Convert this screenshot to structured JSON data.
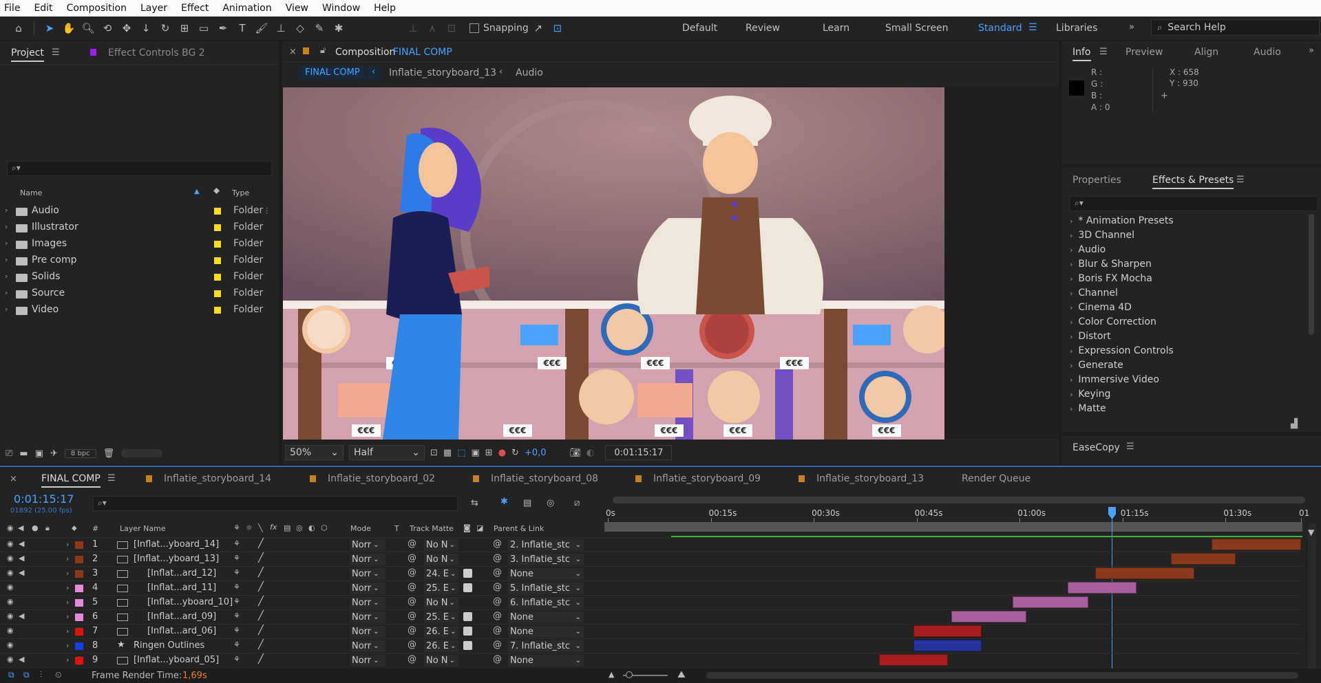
{
  "menu": [
    "File",
    "Edit",
    "Composition",
    "Layer",
    "Effect",
    "Animation",
    "View",
    "Window",
    "Help"
  ],
  "toolbar": {
    "snapping": "Snapping",
    "workspaces": [
      "Default",
      "Review",
      "Learn",
      "Small Screen",
      "Standard",
      "Libraries"
    ],
    "active_workspace": "Standard",
    "search_help": "Search Help"
  },
  "project": {
    "tab": "Project",
    "effect_controls": "Effect Controls BG 2",
    "col_name": "Name",
    "col_type": "Type",
    "bpc": "8 bpc",
    "items": [
      {
        "name": "Audio",
        "type": "Folder"
      },
      {
        "name": "Illustrator",
        "type": "Folder"
      },
      {
        "name": "Images",
        "type": "Folder"
      },
      {
        "name": "Pre comp",
        "type": "Folder"
      },
      {
        "name": "Solids",
        "type": "Folder"
      },
      {
        "name": "Source",
        "type": "Folder"
      },
      {
        "name": "Video",
        "type": "Folder"
      }
    ]
  },
  "comp": {
    "tab_prefix": "Composition",
    "tab_name": "FINAL COMP",
    "crumbs": [
      "FINAL COMP",
      "Inflatie_storyboard_13",
      "Audio"
    ],
    "zoom": "50%",
    "resolution": "Half",
    "exposure": "+0,0",
    "timecode": "0:01:15:17",
    "price_tag": "€€€"
  },
  "info": {
    "tabs": [
      "Info",
      "Preview",
      "Align",
      "Audio"
    ],
    "r": "R :",
    "g": "G :",
    "b": "B :",
    "a": "A :  0",
    "x": "X : 658",
    "y": "Y : 930"
  },
  "effects": {
    "tabs": [
      "Properties",
      "Effects & Presets"
    ],
    "items": [
      "* Animation Presets",
      "3D Channel",
      "Audio",
      "Blur & Sharpen",
      "Boris FX Mocha",
      "Channel",
      "Cinema 4D",
      "Color Correction",
      "Distort",
      "Expression Controls",
      "Generate",
      "Immersive Video",
      "Keying",
      "Matte"
    ],
    "easecopy": "EaseCopy"
  },
  "timeline": {
    "tabs": [
      "FINAL COMP",
      "Inflatie_storyboard_14",
      "Inflatie_storyboard_02",
      "Inflatie_storyboard_08",
      "Inflatie_storyboard_09",
      "Inflatie_storyboard_13",
      "Render Queue"
    ],
    "timecode": "0:01:15:17",
    "fps": "01892 (25.00 fps)",
    "headers": {
      "num": "#",
      "layer": "Layer Name",
      "mode": "Mode",
      "t": "T",
      "matte": "Track Matte",
      "parent": "Parent & Link"
    },
    "ruler": [
      "0s",
      "00:15s",
      "00:30s",
      "00:45s",
      "01:00s",
      "01:15s",
      "01:30s",
      "01"
    ],
    "render_time_label": "Frame Render Time:",
    "render_time": "1,69s",
    "layers": [
      {
        "num": "1",
        "name": "[Inflat...yboard_14]",
        "mode": "Norr",
        "matte": "No N",
        "parent": "2. Inflatie_stc",
        "color": "#8b3a1e",
        "start": 88,
        "end": 101,
        "barcolor": "#8c3a1e"
      },
      {
        "num": "2",
        "name": "[Inflat...yboard_13]",
        "mode": "Norr",
        "matte": "No N",
        "parent": "3. Inflatie_stc",
        "color": "#8b3a1e",
        "start": 82,
        "end": 91.5,
        "barcolor": "#8c3a1e"
      },
      {
        "num": "3",
        "name": "[Inflat...ard_12]",
        "mode": "Norr",
        "matte": "24. E",
        "parent": "None",
        "color": "#8b3a1e",
        "start": 71,
        "end": 85.5,
        "barcolor": "#8c3a1e"
      },
      {
        "num": "4",
        "name": "[Inflat...ard_11]",
        "mode": "Norr",
        "matte": "25. E",
        "parent": "5. Inflatie_stc",
        "color": "#e58ad8",
        "start": 67,
        "end": 77,
        "barcolor": "#a95ea0"
      },
      {
        "num": "5",
        "name": "[Inflat...yboard_10]",
        "mode": "Norr",
        "matte": "No N",
        "parent": "6. Inflatie_stc",
        "color": "#e58ad8",
        "start": 59,
        "end": 70,
        "barcolor": "#a95ea0"
      },
      {
        "num": "6",
        "name": "[Inflat...ard_09]",
        "mode": "Norr",
        "matte": "25. E",
        "parent": "None",
        "color": "#e58ad8",
        "start": 50,
        "end": 61,
        "barcolor": "#a95ea0"
      },
      {
        "num": "7",
        "name": "[Inflat...ard_06]",
        "mode": "Norr",
        "matte": "26. E",
        "parent": "None",
        "color": "#e01010",
        "start": 44.5,
        "end": 54.5,
        "barcolor": "#a81e1e"
      },
      {
        "num": "8",
        "name": "Ringen Outlines",
        "mode": "Norr",
        "matte": "26. E",
        "parent": "7. Inflatie_stc",
        "color": "#1a3fe0",
        "start": 44.5,
        "end": 54.5,
        "barcolor": "#2632a0"
      },
      {
        "num": "9",
        "name": "[Inflat...yboard_05]",
        "mode": "Norr",
        "matte": "No N",
        "parent": "None",
        "color": "#e01010",
        "start": 39.5,
        "end": 49.5,
        "barcolor": "#a81e1e"
      }
    ]
  }
}
